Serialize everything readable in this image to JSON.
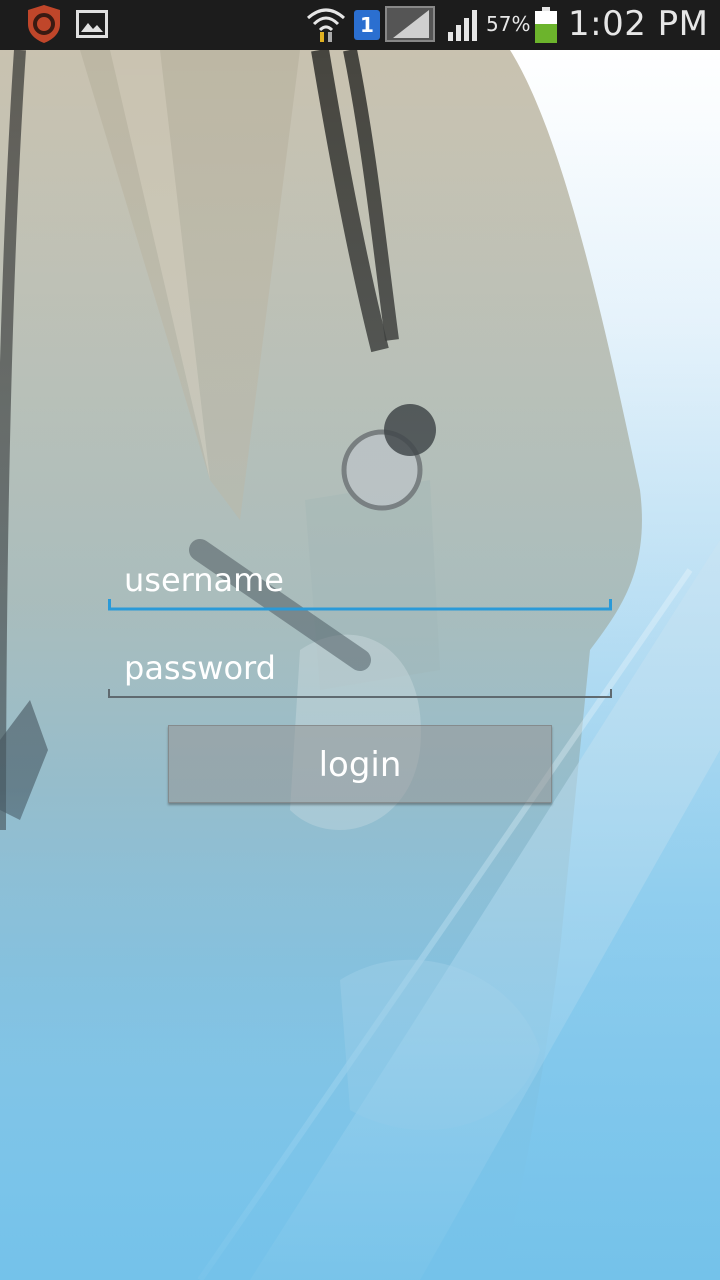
{
  "status_bar": {
    "battery_percent": "57%",
    "clock": "1:02 PM",
    "sim_label": "1",
    "icons": [
      "shield-app-icon",
      "image-icon",
      "wifi-icon",
      "sim-icon",
      "signal-icon",
      "signal-icon",
      "battery-icon"
    ]
  },
  "login_form": {
    "username_placeholder": "username",
    "username_value": "",
    "password_placeholder": "password",
    "password_value": "",
    "login_label": "login"
  },
  "colors": {
    "status_bar": "#1c1c1c",
    "accent_underline": "#2a9ad8",
    "background_bottom": "#74c2ea"
  }
}
